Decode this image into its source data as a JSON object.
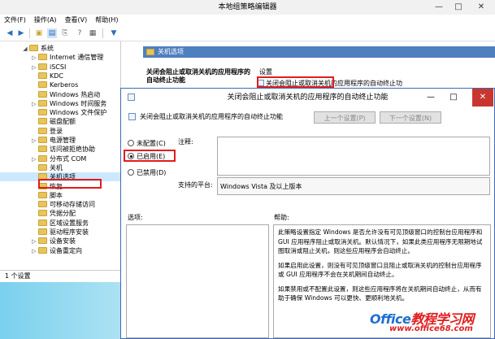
{
  "main_window": {
    "title": "本地组策略编辑器",
    "controls": {
      "minimize": "—",
      "maximize": "□",
      "close": "✕"
    },
    "menu": [
      "文件(F)",
      "操作(A)",
      "查看(V)",
      "帮助(H)"
    ],
    "tree": [
      {
        "label": "系统",
        "depth": 1,
        "expander": "◢"
      },
      {
        "label": "Internet 通信管理",
        "depth": 2,
        "expander": "▷"
      },
      {
        "label": "iSCSI",
        "depth": 2,
        "expander": "▷"
      },
      {
        "label": "KDC",
        "depth": 2,
        "expander": ""
      },
      {
        "label": "Kerberos",
        "depth": 2,
        "expander": ""
      },
      {
        "label": "Windows 热启动",
        "depth": 2,
        "expander": ""
      },
      {
        "label": "Windows 时间服务",
        "depth": 2,
        "expander": "▷"
      },
      {
        "label": "Windows 文件保护",
        "depth": 2,
        "expander": ""
      },
      {
        "label": "磁盘配额",
        "depth": 2,
        "expander": ""
      },
      {
        "label": "登录",
        "depth": 2,
        "expander": ""
      },
      {
        "label": "电源管理",
        "depth": 2,
        "expander": "▷"
      },
      {
        "label": "访问被拒绝协助",
        "depth": 2,
        "expander": ""
      },
      {
        "label": "分布式 COM",
        "depth": 2,
        "expander": "▷"
      },
      {
        "label": "关机",
        "depth": 2,
        "expander": ""
      },
      {
        "label": "关机选项",
        "depth": 2,
        "expander": "",
        "selected": true
      },
      {
        "label": "恢复",
        "depth": 2,
        "expander": ""
      },
      {
        "label": "脚本",
        "depth": 2,
        "expander": ""
      },
      {
        "label": "可移动存储访问",
        "depth": 2,
        "expander": ""
      },
      {
        "label": "凭据分配",
        "depth": 2,
        "expander": ""
      },
      {
        "label": "区域设置服务",
        "depth": 2,
        "expander": ""
      },
      {
        "label": "驱动程序安装",
        "depth": 2,
        "expander": ""
      },
      {
        "label": "设备安装",
        "depth": 2,
        "expander": "▷"
      },
      {
        "label": "设备重定向",
        "depth": 2,
        "expander": "▷"
      }
    ],
    "right_pane": {
      "header": "关机选项",
      "description": "关闭会阻止或取消关机的应用程序的自动终止功能",
      "column_header": "设置",
      "setting_item": "关闭会阻止或取消关机的应用程序的自动终止功"
    },
    "status": "1 个设置"
  },
  "dialog": {
    "title": "关闭会阻止或取消关机的应用程序的自动终止功能",
    "header_text": "关闭会阻止或取消关机的应用程序的自动终止功能",
    "prev_button": "上一个设置(P)",
    "next_button": "下一个设置(N)",
    "controls": {
      "minimize": "—",
      "maximize": "□",
      "close": "✕"
    },
    "radio_options": [
      {
        "label": "未配置(C)",
        "checked": false
      },
      {
        "label": "已启用(E)",
        "checked": true
      },
      {
        "label": "已禁用(D)",
        "checked": false
      }
    ],
    "comment_label": "注释:",
    "supported_label": "支持的平台:",
    "supported_value": "Windows Vista 及以上版本",
    "options_label": "选项:",
    "help_label": "帮助:",
    "help_paragraphs": [
      "此策略设置指定 Windows 是否允许没有可见顶级窗口的控制台应用程序和 GUI 应用程序阻止或取消关机。默认情况下，如果此类应用程序无限期地试图取消或阻止关机，则这些应用程序会自动终止。",
      "如果启用此设置，则没有可见顶级窗口且阻止或取消关机的控制台应用程序或 GUI 应用程序不会在关机期间自动终止。",
      "如果禁用或不配置此设置，则这些应用程序将在关机期间自动终止，从而有助于确保 Windows 可以更快、更顺利地关机。"
    ]
  },
  "watermark": {
    "logo_parts": [
      "Office",
      "教程学习网"
    ],
    "url": "www.office68.com"
  }
}
